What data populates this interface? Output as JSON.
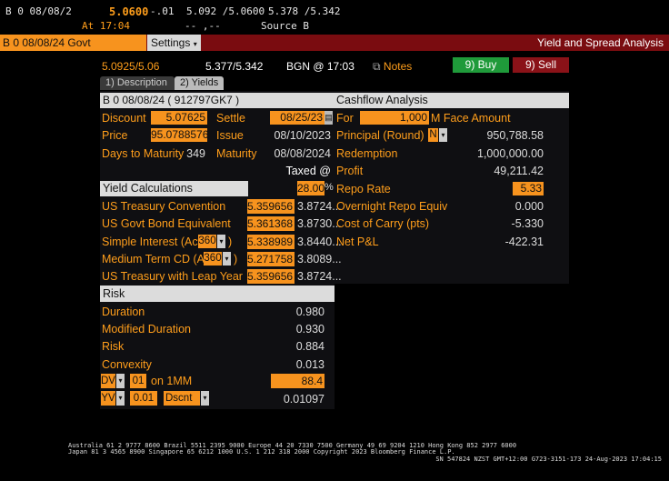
{
  "ticker_bar": {
    "security_short": "B 0 08/08/2",
    "last_price": "5.0600",
    "change": "-.01",
    "bid_ask": "5.092 /5.0600",
    "hi_lo": "5.378 /5.342",
    "at_time": "At 17:04",
    "dash_field": "-- ,--",
    "source": "Source B"
  },
  "title_bar": {
    "security": "B 0 08/08/24 Govt",
    "settings": "Settings",
    "screen_title": "Yield and Spread Analysis"
  },
  "quote_row": {
    "bid_ask_yield": "5.0925/5.06",
    "bid_ask_price": "5.377/5.342",
    "source_time": "BGN @ 17:03",
    "notes": "Notes",
    "buy": "9) Buy",
    "sell": "9) Sell"
  },
  "tabs": [
    {
      "label": "1) Description"
    },
    {
      "label": "2) Yields"
    }
  ],
  "security_header": "B 0 08/08/24 ( 912797GK7 )",
  "fields": {
    "discount_label": "Discount",
    "discount_value": "5.07625",
    "settle_label": "Settle",
    "settle_value": "08/25/23",
    "price_label": "Price",
    "price_value": "95.0788576",
    "issue_label": "Issue",
    "issue_value": "08/10/2023",
    "dtm_label": "Days to Maturity",
    "dtm_value": "349",
    "maturity_label": "Maturity",
    "maturity_value": "08/08/2024",
    "taxed_label": "Taxed @",
    "taxed_value": "28.00",
    "taxed_unit": "%"
  },
  "yield_calc": {
    "header": "Yield Calculations",
    "rows": [
      {
        "label": "US Treasury Convention",
        "value": "5.359656",
        "taxed": "3.8724..."
      },
      {
        "label": "US Govt Bond Equivalent",
        "value": "5.361368",
        "taxed": "3.8730..."
      },
      {
        "label": "Simple Interest (Act/",
        "dropdown": "360",
        "suffix": ")",
        "value": "5.338989",
        "taxed": "3.8440..."
      },
      {
        "label": "Medium Term CD (Act/",
        "dropdown": "360",
        "suffix": ")",
        "value": "5.271758",
        "taxed": "3.8089..."
      },
      {
        "label": "US Treasury with Leap Year",
        "value": "5.359656",
        "taxed": "3.8724..."
      }
    ]
  },
  "risk": {
    "header": "Risk",
    "rows": [
      {
        "label": "Duration",
        "value": "0.980"
      },
      {
        "label": "Modified Duration",
        "value": "0.930"
      },
      {
        "label": "Risk",
        "value": "0.884"
      },
      {
        "label": "Convexity",
        "value": "0.013"
      }
    ],
    "dv_dropdown": "DV",
    "dv_amount": "01",
    "dv_on": "on 1MM",
    "dv_value": "88.4",
    "yv_dropdown": "YV",
    "yv_amount": "0.01",
    "yv_type": "Dscnt",
    "yv_value": "0.01097"
  },
  "cashflow": {
    "header": "Cashflow Analysis",
    "for_label": "For",
    "for_value": "1,000",
    "face_label": "M Face Amount",
    "rows": [
      {
        "label": "Principal (Round)",
        "value": "950,788.58"
      },
      {
        "label": "Redemption",
        "value": "1,000,000.00"
      },
      {
        "label": "Profit",
        "value": "49,211.42"
      },
      {
        "label": "Repo Rate",
        "value": "5.33"
      },
      {
        "label": "Overnight Repo Equiv",
        "value": "0.000"
      },
      {
        "label": "Cost of Carry (pts)",
        "value": "-5.330"
      },
      {
        "label": "Net P&L",
        "value": "-422.31"
      }
    ],
    "principal_dropdown": "N"
  },
  "footer": {
    "line1": "Australia 61 2 9777 8600 Brazil 5511 2395 9000 Europe 44 20 7330 7500 Germany 49 69 9204 1210 Hong Kong 852 2977 6000",
    "line2": "Japan 81 3 4565 8900      Singapore 65 6212 1000      U.S. 1 212 318 2000         Copyright 2023 Bloomberg Finance L.P.",
    "line3": "SN 547824 NZST GMT+12:00 G723-3151-173 24-Aug-2023 17:04:15"
  },
  "colors": {
    "accent": "#f7931e",
    "title_bar": "#7a0c10",
    "buy": "#1f9a3a",
    "sell": "#8a1218"
  }
}
